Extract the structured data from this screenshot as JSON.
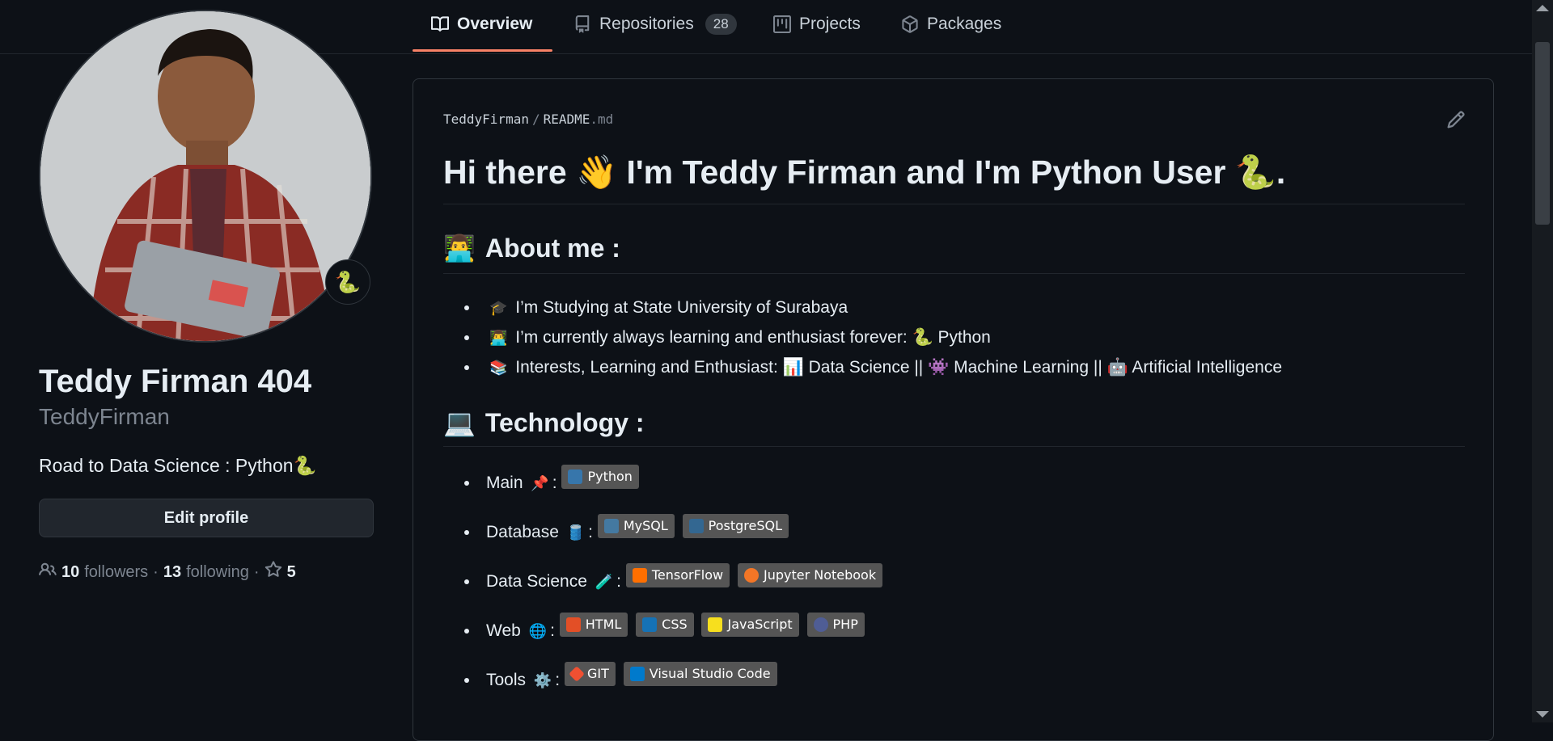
{
  "nav": {
    "tabs": [
      {
        "label": "Overview",
        "icon": "book-icon",
        "active": true
      },
      {
        "label": "Repositories",
        "icon": "repo-icon",
        "count": "28"
      },
      {
        "label": "Projects",
        "icon": "project-icon"
      },
      {
        "label": "Packages",
        "icon": "package-icon"
      }
    ]
  },
  "profile": {
    "display_name": "Teddy Firman 404",
    "username": "TeddyFirman",
    "bio": "Road to Data Science : Python",
    "bio_emoji": "🐍",
    "status_emoji": "🐍",
    "edit_label": "Edit profile",
    "followers_count": "10",
    "followers_label": "followers",
    "following_count": "13",
    "following_label": "following",
    "stars_count": "5",
    "separator": "·"
  },
  "readme": {
    "owner": "TeddyFirman",
    "file_base": "README",
    "file_ext": ".md",
    "path_sep": "/",
    "heading": "Hi there 👋 I'm Teddy Firman and I'm Python User 🐍.",
    "about_title": "About me :",
    "about_emoji": "👨‍💻",
    "about_items": [
      {
        "emoji": "🎓",
        "text": "I’m Studying at State University of Surabaya"
      },
      {
        "emoji": "👨‍💻",
        "text": "I’m currently always learning and enthusiast forever: 🐍 Python"
      },
      {
        "emoji": "📚",
        "text": "Interests, Learning and Enthusiast: 📊 Data Science || 👾 Machine Learning || 🤖 Artificial Intelligence"
      }
    ],
    "tech_title": "Technology :",
    "tech_emoji": "💻",
    "tech_rows": [
      {
        "label": "Main",
        "emoji": "📌",
        "badges": [
          {
            "text": "Python",
            "color": "#3776AB"
          }
        ]
      },
      {
        "label": "Database",
        "emoji": "🛢️",
        "badges": [
          {
            "text": "MySQL",
            "color": "#4479A1"
          },
          {
            "text": "PostgreSQL",
            "color": "#336791"
          }
        ]
      },
      {
        "label": "Data Science",
        "emoji": "🧪",
        "badges": [
          {
            "text": "TensorFlow",
            "color": "#FF6F00"
          },
          {
            "text": "Jupyter Notebook",
            "color": "#F37626"
          }
        ]
      },
      {
        "label": "Web",
        "emoji": "🌐",
        "badges": [
          {
            "text": "HTML",
            "color": "#E34F26"
          },
          {
            "text": "CSS",
            "color": "#1572B6"
          },
          {
            "text": "JavaScript",
            "color": "#F7DF1E"
          },
          {
            "text": "PHP",
            "color": "#4F5D95"
          }
        ]
      },
      {
        "label": "Tools",
        "emoji": "⚙️",
        "badges": [
          {
            "text": "GIT",
            "color": "#F05032"
          },
          {
            "text": "Visual Studio Code",
            "color": "#007ACC"
          }
        ]
      }
    ],
    "tech_colon": ":"
  },
  "colors": {
    "background": "#0d1117",
    "accent_underline": "#f78166",
    "badge_bg": "#555555"
  }
}
